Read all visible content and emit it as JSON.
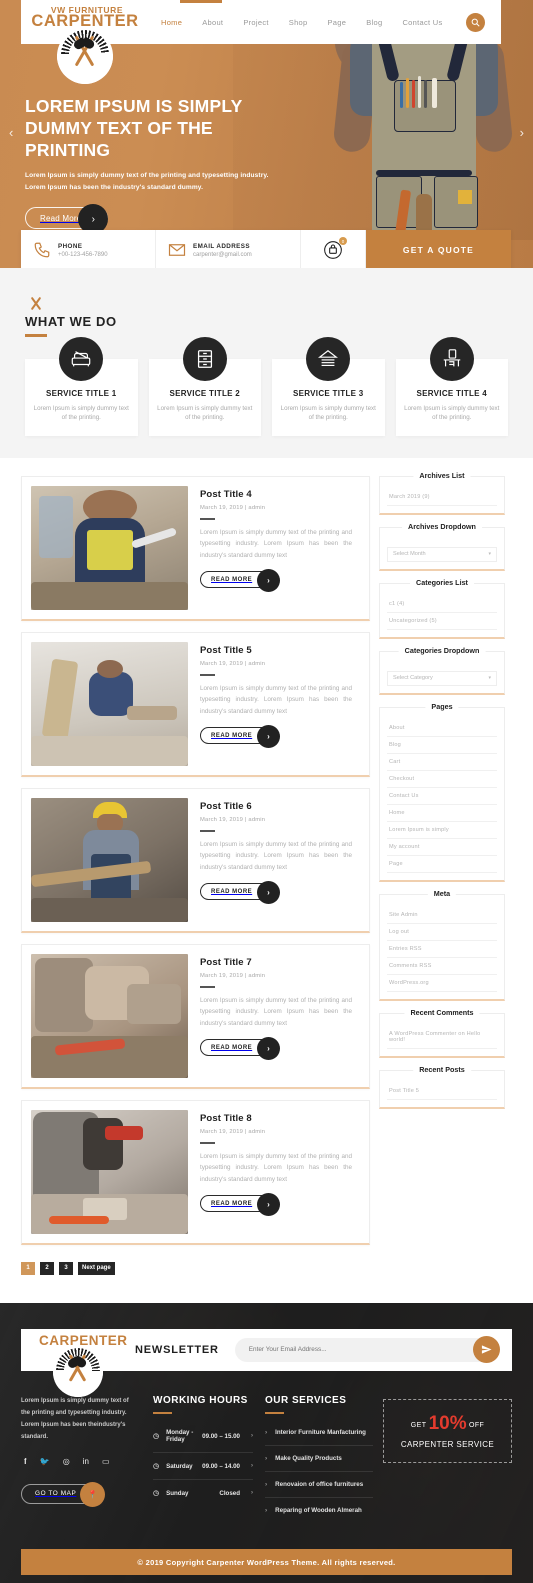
{
  "header": {
    "logo_line1": "VW FURNITURE",
    "logo_line2": "CARPENTER",
    "nav": [
      {
        "label": "Home",
        "active": true
      },
      {
        "label": "About",
        "active": false
      },
      {
        "label": "Project",
        "active": false
      },
      {
        "label": "Shop",
        "active": false
      },
      {
        "label": "Page",
        "active": false
      },
      {
        "label": "Blog",
        "active": false
      },
      {
        "label": "Contact Us",
        "active": false
      }
    ],
    "search_icon": "search-icon"
  },
  "hero": {
    "title": "LOREM IPSUM IS SIMPLY DUMMY TEXT OF THE PRINTING",
    "subtitle": "Lorem Ipsum is simply dummy text of the printing and typesetting industry. Lorem Ipsum has been the industry's standard dummy.",
    "button": "Read More",
    "prev_arrow": "‹",
    "next_arrow": "›"
  },
  "infobar": {
    "phone_label": "PHONE",
    "phone_value": "+00-123-456-7890",
    "email_label": "EMAIL ADDRESS",
    "email_value": "carpenter@gmail.com",
    "cart_count": "0",
    "quote_button": "GET A QUOTE"
  },
  "services": {
    "section_title": "WHAT WE DO",
    "cards": [
      {
        "title": "SERVICE TITLE 1",
        "desc": "Lorem Ipsum is simply dummy text of the printing.",
        "icon": "sofa-icon"
      },
      {
        "title": "SERVICE TITLE 2",
        "desc": "Lorem Ipsum is simply dummy text of the printing.",
        "icon": "drawer-cabinet-icon"
      },
      {
        "title": "SERVICE TITLE 3",
        "desc": "Lorem Ipsum is simply dummy text of the printing.",
        "icon": "cabin-house-icon"
      },
      {
        "title": "SERVICE TITLE 4",
        "desc": "Lorem Ipsum is simply dummy text of the printing.",
        "icon": "table-chair-icon"
      }
    ]
  },
  "blog": {
    "read_more_label": "READ MORE",
    "posts": [
      {
        "title": "Post Title 4",
        "meta": "March 19, 2019 |  admin",
        "text": "Lorem Ipsum is simply dummy text of the printing and typesetting industry. Lorem Ipsum has been the industry's standard dummy text"
      },
      {
        "title": "Post Title 5",
        "meta": "March 19, 2019 |  admin",
        "text": "Lorem Ipsum is simply dummy text of the printing and typesetting industry. Lorem Ipsum has been the industry's standard dummy text"
      },
      {
        "title": "Post Title 6",
        "meta": "March 19, 2019 |  admin",
        "text": "Lorem Ipsum is simply dummy text of the printing and typesetting industry. Lorem Ipsum has been the industry's standard dummy text"
      },
      {
        "title": "Post Title 7",
        "meta": "March 19, 2019 |  admin",
        "text": "Lorem Ipsum is simply dummy text of the printing and typesetting industry. Lorem Ipsum has been the industry's standard dummy text"
      },
      {
        "title": "Post Title 8",
        "meta": "March 19, 2019 |  admin",
        "text": "Lorem Ipsum is simply dummy text of the printing and typesetting industry. Lorem Ipsum has been the industry's standard dummy text"
      }
    ]
  },
  "pagination": {
    "pages": [
      "1",
      "2",
      "3"
    ],
    "next_label": "Next page",
    "current": "1"
  },
  "sidebar": {
    "archives_list": {
      "title": "Archives List",
      "items": [
        "March 2019 (9)"
      ]
    },
    "archives_dropdown": {
      "title": "Archives Dropdown",
      "value": "Select Month"
    },
    "categories_list": {
      "title": "Categories List",
      "items": [
        "c1 (4)",
        "Uncategorized (5)"
      ]
    },
    "categories_dropdown": {
      "title": "Categories Dropdown",
      "value": "Select Category"
    },
    "pages": {
      "title": "Pages",
      "items": [
        "About",
        "Blog",
        "Cart",
        "Checkout",
        "Contact Us",
        "Home",
        "Lorem Ipsum is simply",
        "My account",
        "Page"
      ]
    },
    "meta": {
      "title": "Meta",
      "items": [
        "Site Admin",
        "Log out",
        "Entries RSS",
        "Comments RSS",
        "WordPress.org"
      ]
    },
    "recent_comments": {
      "title": "Recent Comments",
      "items": [
        "A WordPress Commenter on Hello world!"
      ]
    },
    "recent_posts": {
      "title": "Recent Posts",
      "items": [
        "Post Title 5"
      ]
    }
  },
  "footer": {
    "logo_text": "CARPENTER",
    "newsletter_label": "NEWSLETTER",
    "newsletter_placeholder": "Enter Your Email Address...",
    "newsletter_send_icon": "send-icon",
    "about_text": "Lorem Ipsum is simply dummy text of the printing and typesetting industry. Lorem Ipsum has been theindustry's standard.",
    "social": [
      "facebook-icon",
      "twitter-icon",
      "instagram-icon",
      "linkedin-icon",
      "youtube-icon"
    ],
    "map_button": "GO TO MAP",
    "working_hours": {
      "title": "WORKING HOURS",
      "rows": [
        {
          "day": "Monday - Friday",
          "time": "09.00 – 15.00"
        },
        {
          "day": "Saturday",
          "time": "09.00 – 14.00"
        },
        {
          "day": "Sunday",
          "time": "Closed"
        }
      ]
    },
    "our_services": {
      "title": "OUR SERVICES",
      "items": [
        "Interior Furniture Manfacturing",
        "Make Quality Products",
        "Renovaion of office furnitures",
        "Reparing of Wooden Almerah"
      ]
    },
    "promo": {
      "prefix": "GET",
      "percent": "10%",
      "suffix": "OFF",
      "line2": "CARPENTER SERVICE"
    },
    "copyright": "© 2019 Copyright Carpenter WordPress Theme. All rights reserved."
  },
  "colors": {
    "accent": "#c4813f",
    "dark": "#262626",
    "promo_red": "#e33b2e"
  }
}
